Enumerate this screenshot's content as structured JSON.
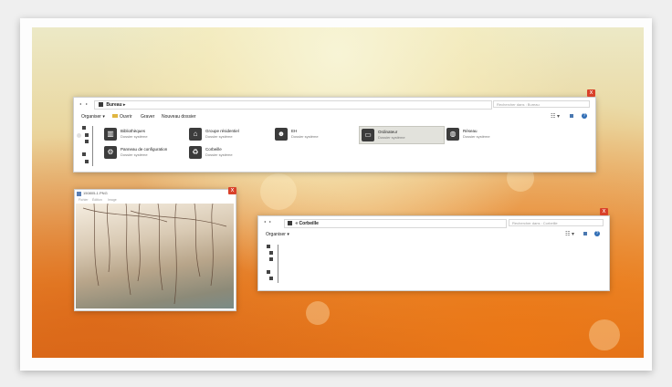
{
  "explorer": {
    "close_glyph": "x",
    "nav_back": "◂",
    "nav_forward": "▸",
    "breadcrumb_folder_icon": "folder-icon",
    "breadcrumb": "Bureau",
    "breadcrumb_arrow": "▸",
    "search_placeholder": "Rechercher dans : Bureau",
    "toolbar": {
      "organize": "Organiser ▾",
      "open": "Ouvrir",
      "burn": "Graver",
      "new_folder": "Nouveau dossier"
    },
    "items": [
      {
        "name": "Bibliothèques",
        "type": "Dossier système",
        "icon": "library-icon",
        "glyph": "▥"
      },
      {
        "name": "Groupe résidentiel",
        "type": "Dossier système",
        "icon": "homegroup-icon",
        "glyph": "⌂"
      },
      {
        "name": "EH",
        "type": "Dossier système",
        "icon": "user-icon",
        "glyph": "☻"
      },
      {
        "name": "Ordinateur",
        "type": "Dossier système",
        "icon": "computer-icon",
        "glyph": "▭"
      },
      {
        "name": "Réseau",
        "type": "Dossier système",
        "icon": "network-icon",
        "glyph": "◍"
      },
      {
        "name": "Panneau de configuration",
        "type": "Dossier système",
        "icon": "control-panel-icon",
        "glyph": "⚙"
      },
      {
        "name": "Corbeille",
        "type": "Dossier système",
        "icon": "recycle-bin-icon",
        "glyph": "♻"
      }
    ],
    "view_tools": "☷ ▾"
  },
  "viewer": {
    "title": "150805-1.PNG",
    "menu": [
      "Fichier",
      "Édition",
      "Image"
    ],
    "close_glyph": "x"
  },
  "recycle": {
    "close_glyph": "x",
    "breadcrumb": "« Corbeille",
    "search_placeholder": "Rechercher dans : Corbeille",
    "toolbar": {
      "organize": "Organiser ▾"
    },
    "view_tools": "☷ ▾"
  },
  "colors": {
    "close_button": "#d9412a",
    "selected_tile": "#e2e2dc",
    "help_icon": "#2f6db5"
  }
}
